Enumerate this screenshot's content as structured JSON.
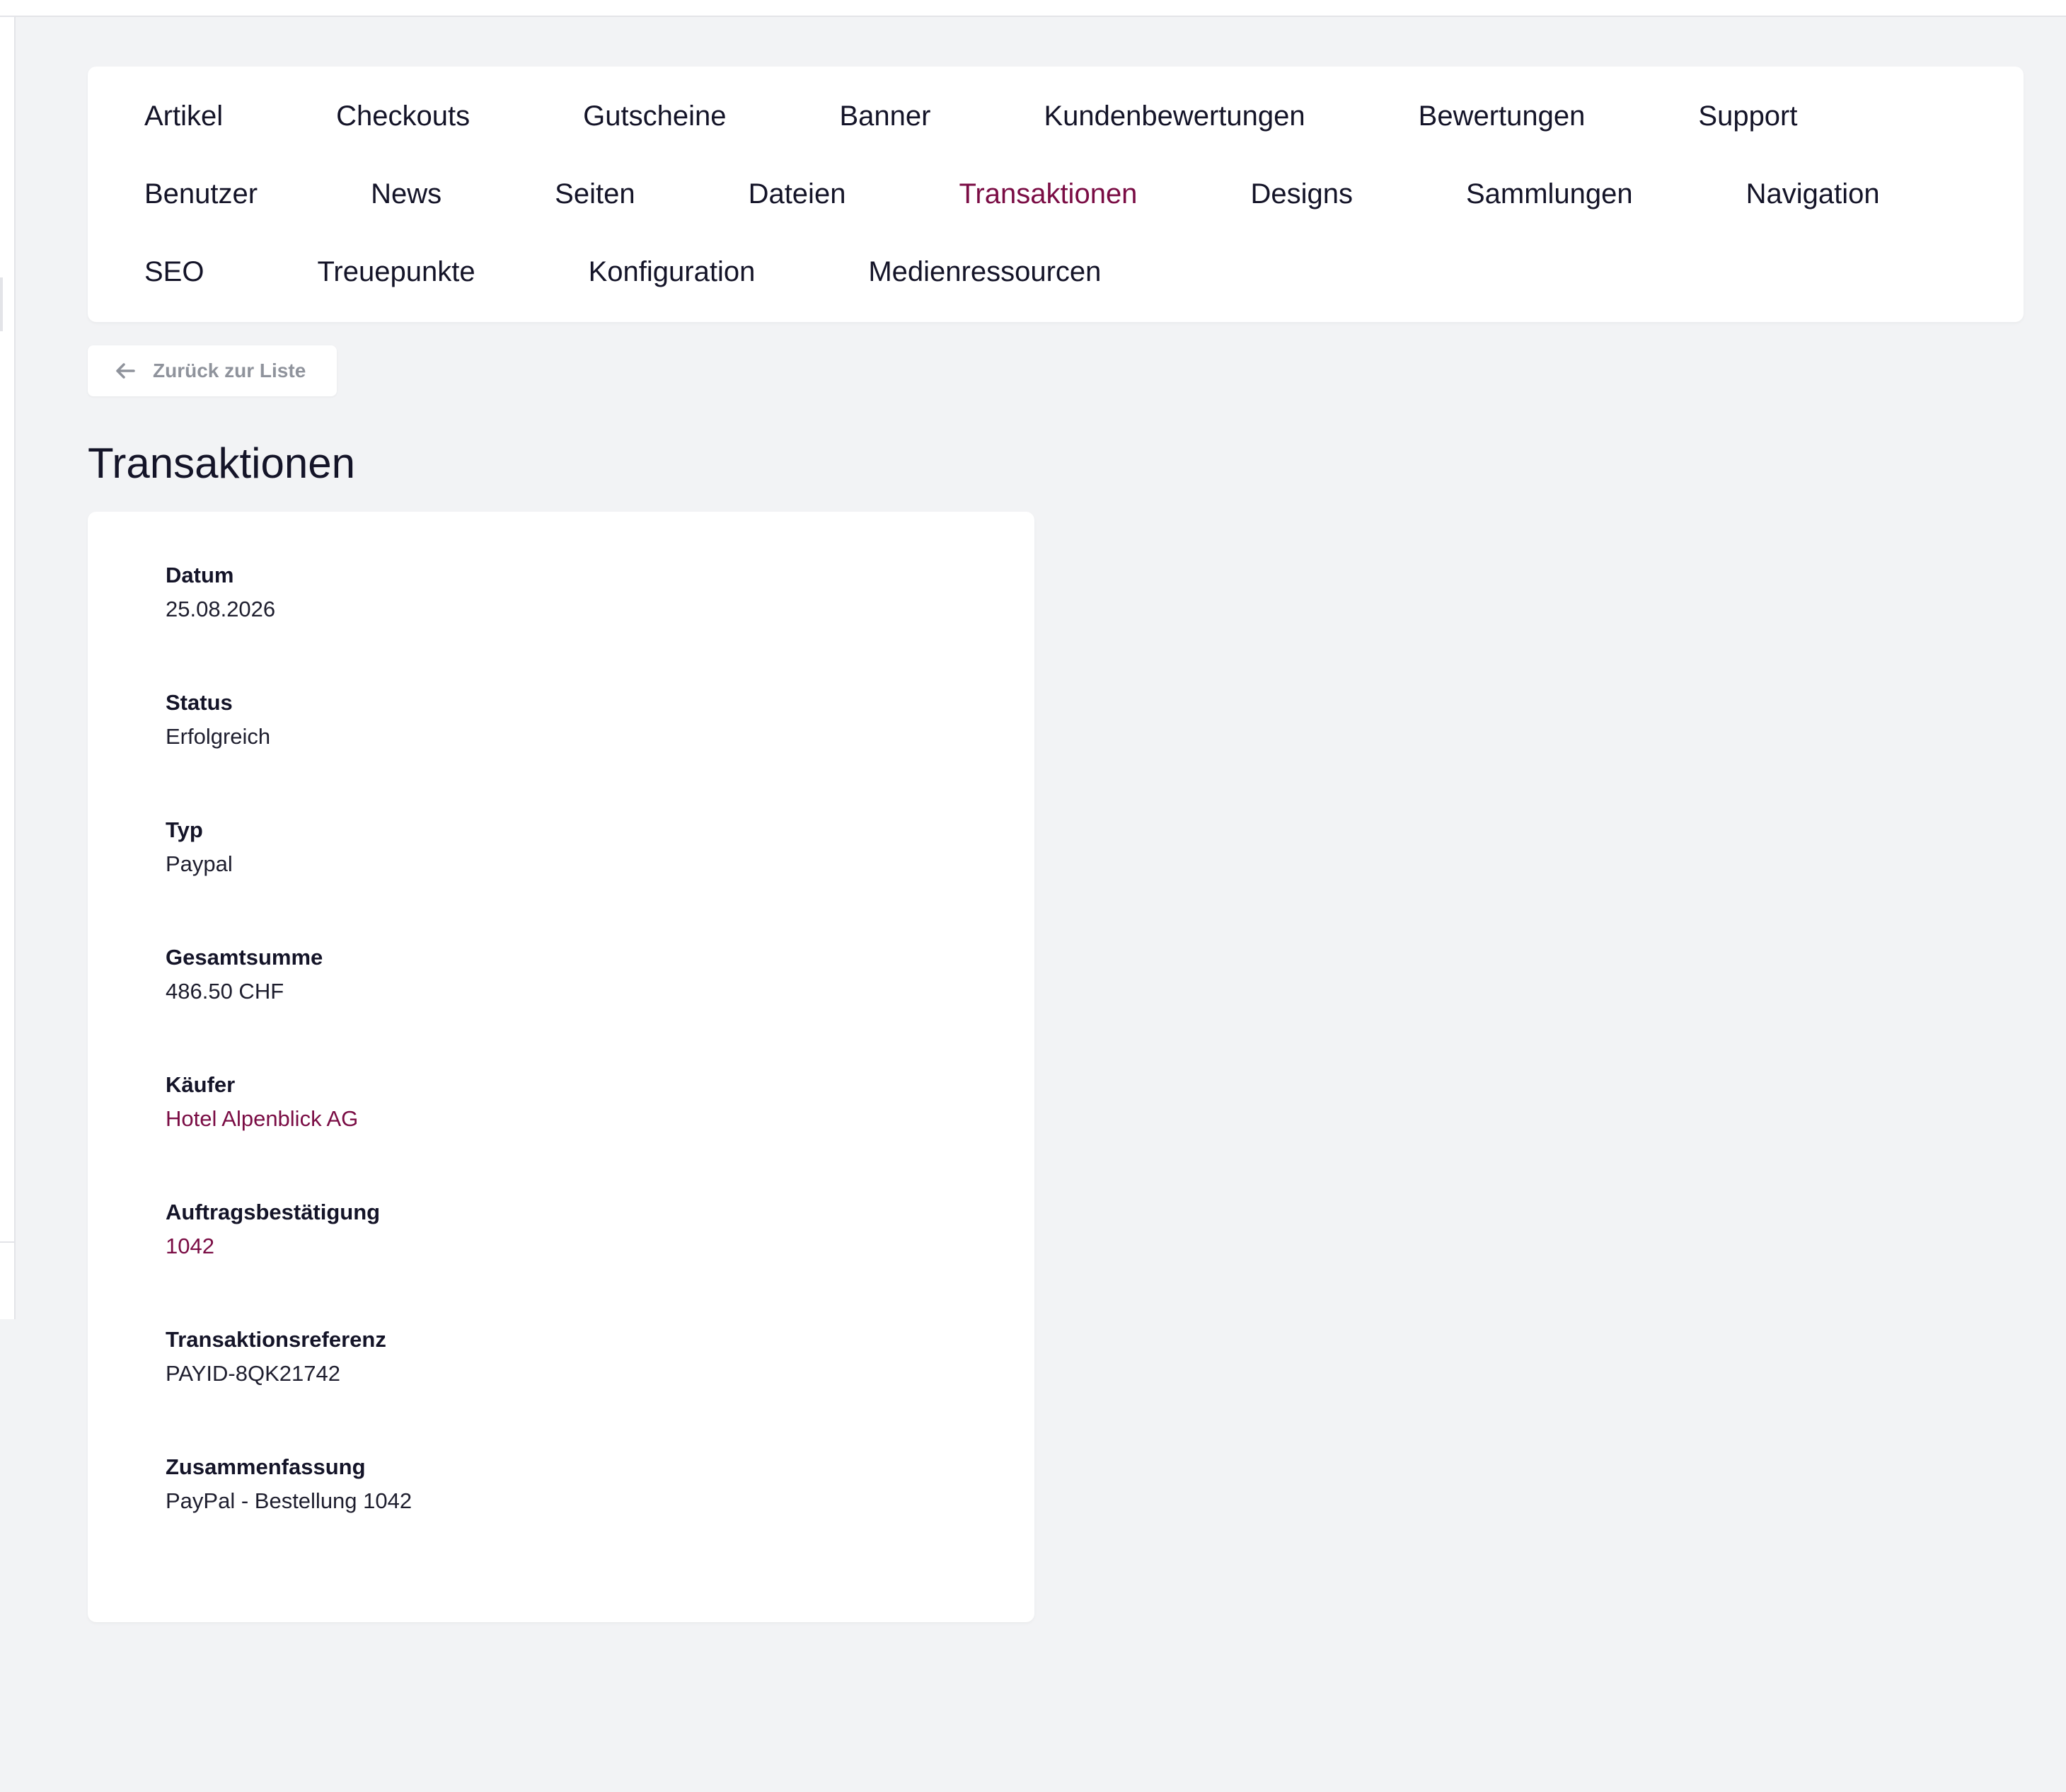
{
  "colors": {
    "accent": "#7a0c44",
    "page_background": "#f2f3f5",
    "card_background": "#ffffff",
    "muted_text": "#8f939c"
  },
  "nav": {
    "rows": [
      [
        "Artikel",
        "Checkouts",
        "Gutscheine",
        "Banner",
        "Kundenbewertungen",
        "Bewertungen",
        "Support"
      ],
      [
        "Benutzer",
        "News",
        "Seiten",
        "Dateien",
        "Transaktionen",
        "Designs",
        "Sammlungen",
        "Navigation"
      ],
      [
        "SEO",
        "Treuepunkte",
        "Konfiguration",
        "Medienressourcen"
      ]
    ],
    "active": "Transaktionen"
  },
  "back_button": {
    "label": "Zurück zur Liste",
    "icon": "arrow-left-icon"
  },
  "page_title": "Transaktionen",
  "details": [
    {
      "label": "Datum",
      "value": "25.08.2026",
      "link": false
    },
    {
      "label": "Status",
      "value": "Erfolgreich",
      "link": false
    },
    {
      "label": "Typ",
      "value": "Paypal",
      "link": false
    },
    {
      "label": "Gesamtsumme",
      "value": "486.50 CHF",
      "link": false
    },
    {
      "label": "Käufer",
      "value": "Hotel Alpenblick AG",
      "link": true
    },
    {
      "label": "Auftragsbestätigung",
      "value": "1042",
      "link": true
    },
    {
      "label": "Transaktionsreferenz",
      "value": "PAYID-8QK21742",
      "link": false
    },
    {
      "label": "Zusammenfassung",
      "value": "PayPal - Bestellung 1042",
      "link": false
    }
  ]
}
